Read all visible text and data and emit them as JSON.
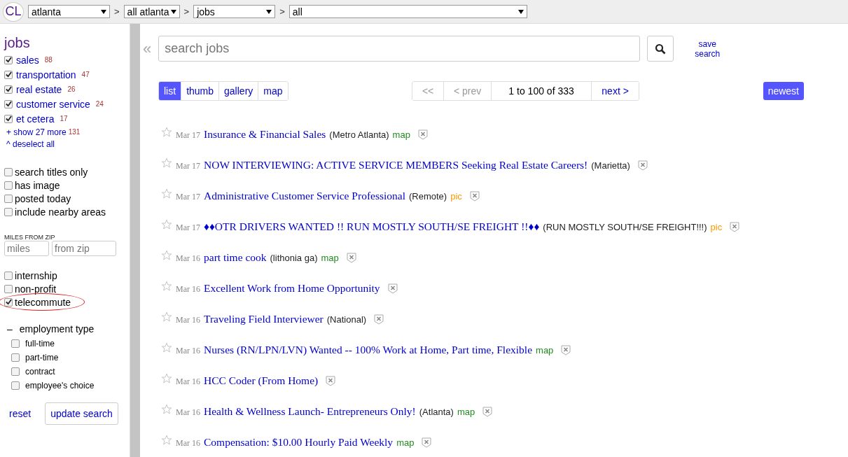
{
  "header": {
    "logo": "CL",
    "breadcrumbs": [
      {
        "value": "atlanta"
      },
      {
        "value": "all atlanta"
      },
      {
        "value": "jobs"
      },
      {
        "value": "all"
      }
    ],
    "separator": ">"
  },
  "sidebar": {
    "title": "jobs",
    "categories": [
      {
        "label": "sales",
        "count": "88",
        "checked": true
      },
      {
        "label": "transportation",
        "count": "47",
        "checked": true
      },
      {
        "label": "real estate",
        "count": "26",
        "checked": true
      },
      {
        "label": "customer service",
        "count": "24",
        "checked": true
      },
      {
        "label": "et cetera",
        "count": "17",
        "checked": true
      }
    ],
    "show_more": {
      "label": "+ show 27 more",
      "count": "131"
    },
    "deselect": "^ deselect all",
    "filters": [
      {
        "label": "search titles only",
        "checked": false
      },
      {
        "label": "has image",
        "checked": false
      },
      {
        "label": "posted today",
        "checked": false
      },
      {
        "label": "include nearby areas",
        "checked": false
      }
    ],
    "miles_label": "MILES FROM ZIP",
    "miles_placeholder": "miles",
    "zip_placeholder": "from zip",
    "flags": [
      {
        "label": "internship",
        "checked": false,
        "circled": false
      },
      {
        "label": "non-profit",
        "checked": false,
        "circled": false
      },
      {
        "label": "telecommute",
        "checked": true,
        "circled": true
      }
    ],
    "employment": {
      "toggle": "–",
      "title": "employment type",
      "options": [
        {
          "label": "full-time",
          "checked": false
        },
        {
          "label": "part-time",
          "checked": false
        },
        {
          "label": "contract",
          "checked": false
        },
        {
          "label": "employee's choice",
          "checked": false
        }
      ]
    },
    "reset": "reset",
    "update": "update search"
  },
  "main": {
    "collapse": "«",
    "search_placeholder": "search jobs",
    "save_search": "save search",
    "views": [
      {
        "label": "list",
        "selected": true
      },
      {
        "label": "thumb",
        "selected": false
      },
      {
        "label": "gallery",
        "selected": false
      },
      {
        "label": "map",
        "selected": false
      }
    ],
    "pager": {
      "first": "<<",
      "prev": "< prev",
      "range": "1 to 100 of 333",
      "next": "next >"
    },
    "sort": "newest",
    "rows": [
      {
        "date": "Mar 17",
        "title": "Insurance & Financial Sales",
        "location": "(Metro Atlanta)",
        "tag": {
          "kind": "map",
          "label": "map"
        }
      },
      {
        "date": "Mar 17",
        "title": "NOW INTERVIEWING: ACTIVE SERVICE MEMBERS Seeking Real Estate Careers!",
        "location": "(Marietta)"
      },
      {
        "date": "Mar 17",
        "title": "Administrative Customer Service Professional",
        "location": "(Remote)",
        "tag": {
          "kind": "pic",
          "label": "pic"
        }
      },
      {
        "date": "Mar 17",
        "title": "♦♦OTR DRIVERS WANTED !! RUN MOSTLY SOUTH/SE FREIGHT !!♦♦",
        "location": "(RUN MOSTLY SOUTH/SE FREIGHT!!!)",
        "tag": {
          "kind": "pic",
          "label": "pic"
        }
      },
      {
        "date": "Mar 16",
        "title": "part time cook",
        "location": "(lithonia ga)",
        "tag": {
          "kind": "map",
          "label": "map"
        }
      },
      {
        "date": "Mar 16",
        "title": "Excellent Work from Home Opportunity"
      },
      {
        "date": "Mar 16",
        "title": "Traveling Field Interviewer",
        "location": "(National)"
      },
      {
        "date": "Mar 16",
        "title": "Nurses (RN/LPN/LVN) Wanted -- 100% Work at Home, Part time, Flexible",
        "tag": {
          "kind": "map",
          "label": "map"
        }
      },
      {
        "date": "Mar 16",
        "title": "HCC Coder (From Home)"
      },
      {
        "date": "Mar 16",
        "title": "Health & Wellness Launch- Entrepreneurs Only!",
        "location": "(Atlanta)",
        "tag": {
          "kind": "map",
          "label": "map"
        }
      },
      {
        "date": "Mar 16",
        "title": "Compensation: $10.00 Hourly Paid Weekly",
        "tag": {
          "kind": "map",
          "label": "map"
        }
      }
    ]
  }
}
